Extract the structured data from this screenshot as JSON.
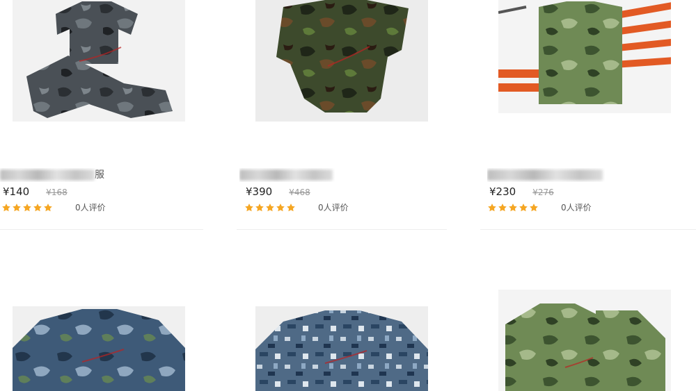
{
  "products": [
    {
      "title_suffix": "服",
      "price": "¥140",
      "old_price": "¥168",
      "reviews": "0人评价",
      "rating": 5
    },
    {
      "title_suffix": "",
      "price": "¥390",
      "old_price": "¥468",
      "reviews": "0人评价",
      "rating": 5
    },
    {
      "title_suffix": "",
      "price": "¥230",
      "old_price": "¥276",
      "reviews": "0人评价",
      "rating": 5
    }
  ],
  "colors": {
    "star": "#f5a623",
    "price": "#222222",
    "old_price": "#999999"
  }
}
